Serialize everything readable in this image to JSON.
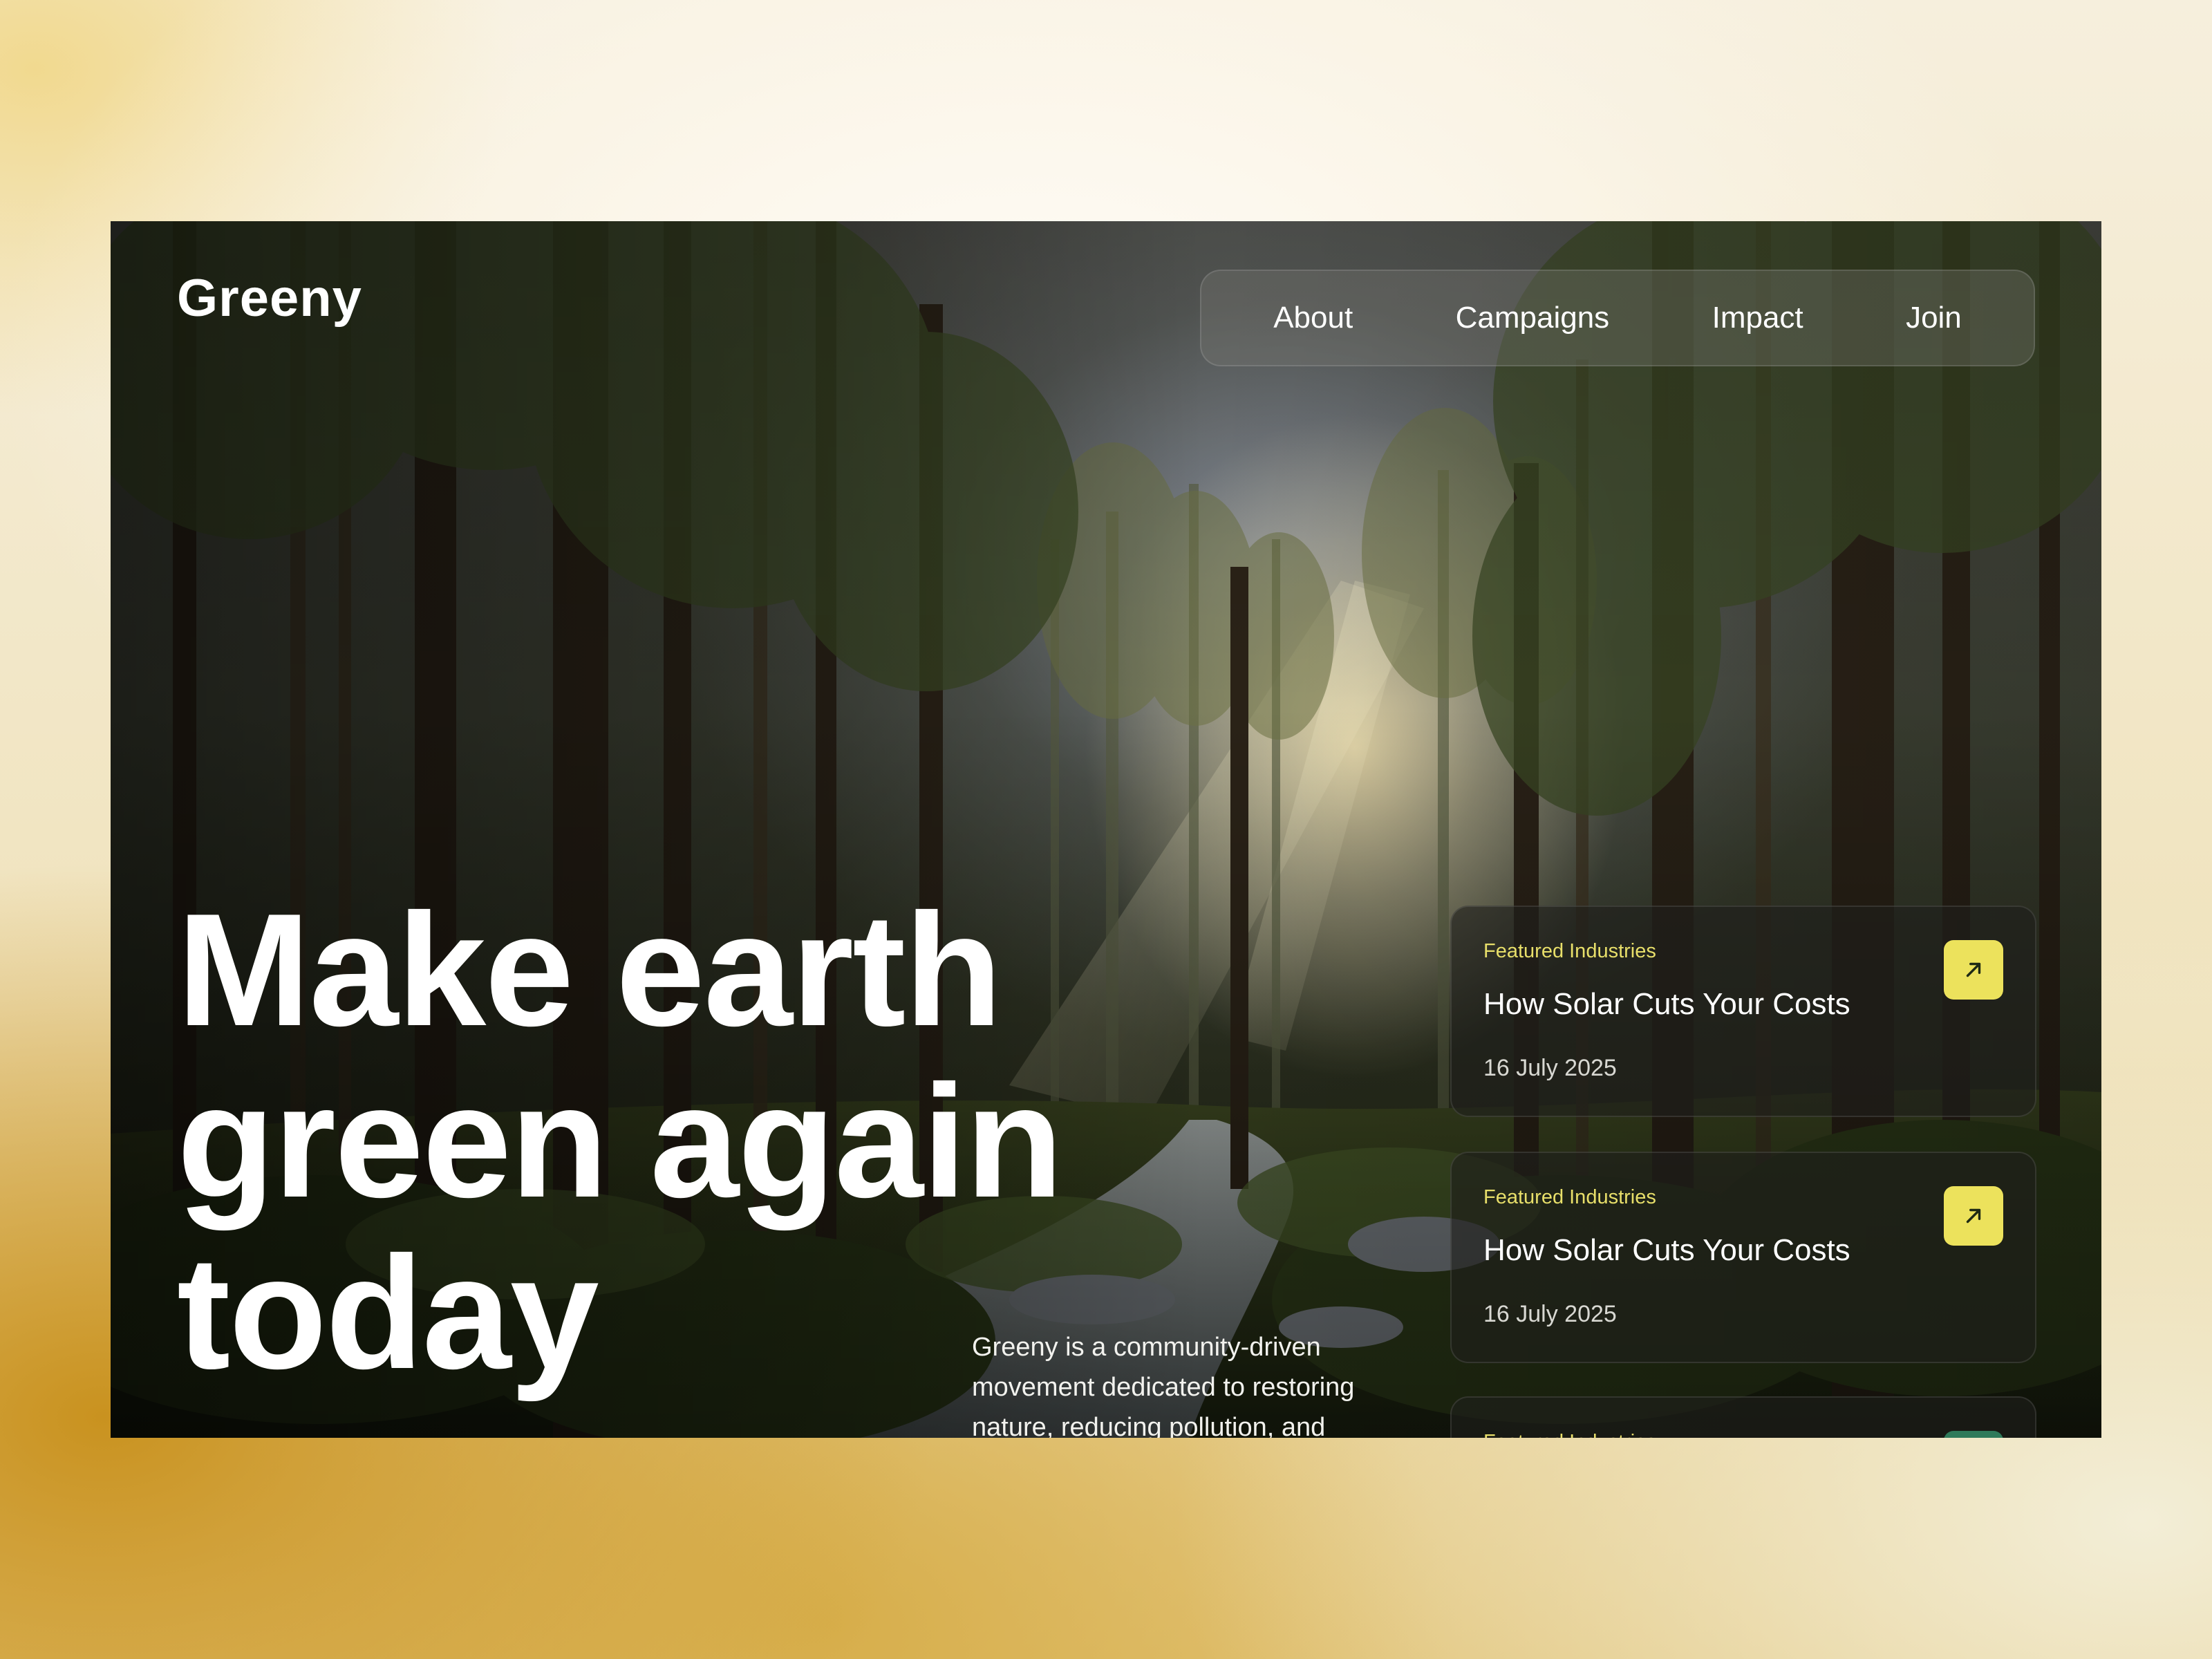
{
  "brand": {
    "name": "Greeny"
  },
  "nav": {
    "items": [
      "About",
      "Campaigns",
      "Impact",
      "Join"
    ]
  },
  "hero": {
    "title_lines": [
      "Make earth",
      "green again",
      "today"
    ],
    "description": "Greeny is a community-driven movement dedicated to restoring nature, reducing pollution, and"
  },
  "cards": [
    {
      "tag": "Featured Industries",
      "title": "How Solar Cuts Your Costs",
      "date": "16 July 2025",
      "icon": "arrow-up-right-icon"
    },
    {
      "tag": "Featured Industries",
      "title": "How Solar Cuts Your Costs",
      "date": "16 July 2025",
      "icon": "arrow-up-right-icon"
    },
    {
      "tag": "Featured Industries",
      "title": "",
      "date": "",
      "icon": "arrow-up-right-icon"
    }
  ],
  "colors": {
    "accent": "#ece25c",
    "tag": "#e8df6a",
    "teal_button": "#2f7a5a"
  }
}
